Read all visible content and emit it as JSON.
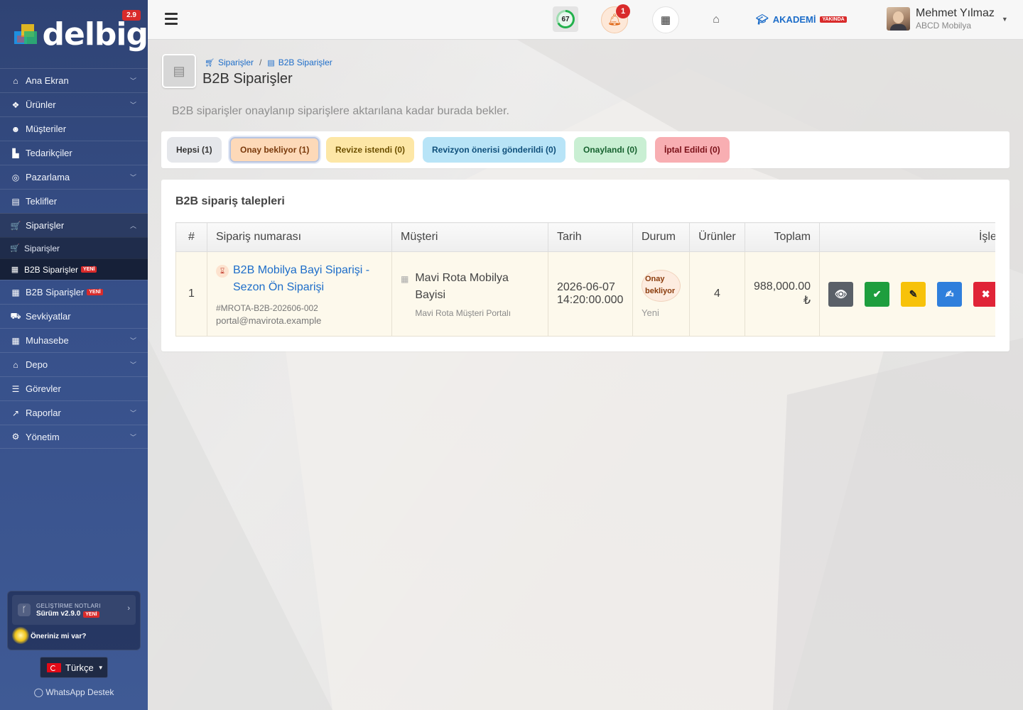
{
  "app": {
    "brand": "delbig",
    "version_badge": "2.9"
  },
  "topbar": {
    "score": "67",
    "notification_count": "1",
    "akademi_label": "AKADEMİ",
    "akademi_badge": "YAKINDA",
    "user_name": "Mehmet Yılmaz",
    "user_company": "ABCD Mobilya"
  },
  "sidebar": {
    "items": [
      {
        "label": "Ana Ekran",
        "icon": "home-icon"
      },
      {
        "label": "Ürünler",
        "icon": "cubes-icon"
      },
      {
        "label": "Müşteriler",
        "icon": "users-icon"
      },
      {
        "label": "Tedarikçiler",
        "icon": "industry-icon"
      },
      {
        "label": "Pazarlama",
        "icon": "target-icon"
      },
      {
        "label": "Teklifler",
        "icon": "file-icon"
      },
      {
        "label": "Siparişler",
        "icon": "cart-icon"
      },
      {
        "label": "B2B Siparişler",
        "icon": "clipboard-icon",
        "tag": "YENİ"
      },
      {
        "label": "Sevkiyatlar",
        "icon": "truck-icon"
      },
      {
        "label": "Muhasebe",
        "icon": "calculator-icon"
      },
      {
        "label": "Depo",
        "icon": "warehouse-icon"
      },
      {
        "label": "Görevler",
        "icon": "tasks-icon"
      },
      {
        "label": "Raporlar",
        "icon": "chart-icon"
      },
      {
        "label": "Yönetim",
        "icon": "cogs-icon"
      }
    ],
    "sub_items": [
      {
        "label": "Siparişler"
      },
      {
        "label": "B2B Siparişler",
        "tag": "YENİ"
      }
    ],
    "dev_notes_title": "GELİŞTİRME NOTLARI",
    "dev_notes_version": "Sürüm v2.9.0",
    "dev_notes_tag": "YENİ",
    "suggestion": "Öneriniz mi var?",
    "language": "Türkçe",
    "whatsapp": "WhatsApp Destek"
  },
  "page": {
    "breadcrumb_1": "Siparişler",
    "breadcrumb_2": "B2B Siparişler",
    "title": "B2B Siparişler",
    "description": "B2B siparişler onaylanıp siparişlere aktarılana kadar burada bekler."
  },
  "filters": {
    "all": "Hepsi (1)",
    "waiting": "Onay bekliyor (1)",
    "revise": "Revize istendi (0)",
    "revision_sent": "Revizyon önerisi gönderildi (0)",
    "approved": "Onaylandı (0)",
    "cancelled": "İptal Edildi (0)"
  },
  "table": {
    "title": "B2B sipariş talepleri",
    "headers": [
      "#",
      "Sipariş numarası",
      "Müşteri",
      "Tarih",
      "Durum",
      "Ürünler",
      "Toplam",
      "İşlemler"
    ],
    "rows": [
      {
        "num": "1",
        "order_title": "B2B Mobilya Bayi Siparişi - Sezon Ön Siparişi",
        "order_code": "#MROTA-B2B-202606-002",
        "order_email": "portal@mavirota.example",
        "customer": "Mavi Rota Mobilya Bayisi",
        "customer_portal": "Mavi Rota Müşteri Portalı",
        "date": "2026-06-07 14:20:00.000",
        "status": "Onay bekliyor",
        "status_sub": "Yeni",
        "products": "4",
        "total": "988,000.00 ₺"
      }
    ]
  }
}
